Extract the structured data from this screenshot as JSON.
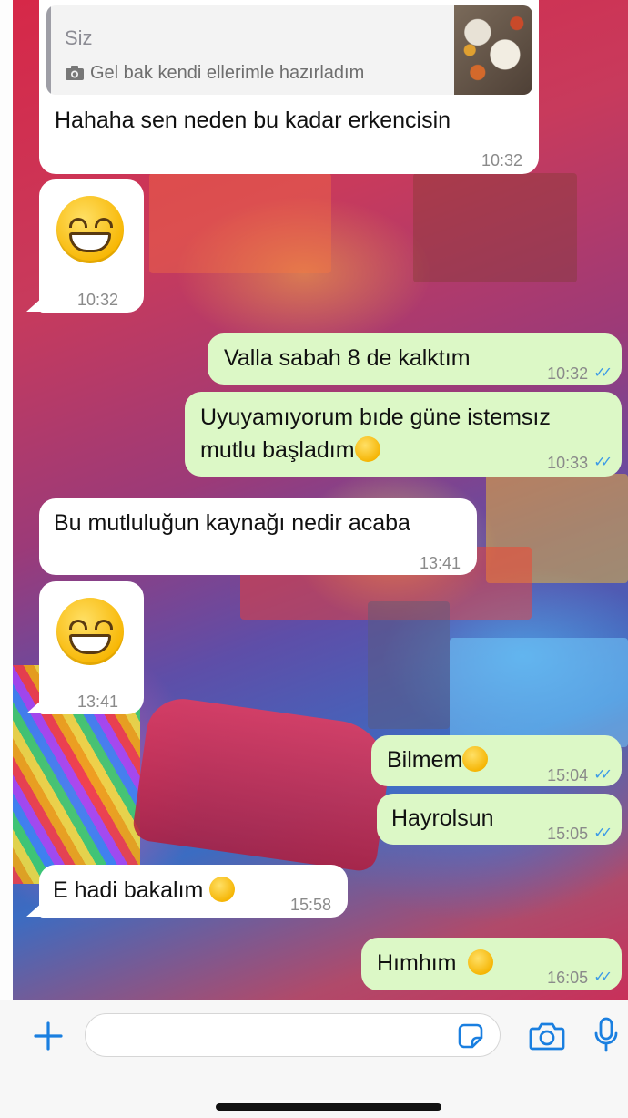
{
  "messages": [
    {
      "id": "m1",
      "direction": "incoming",
      "reply_to": {
        "author": "Siz",
        "icon": "camera-icon",
        "text": "Gel bak kendi ellerimle hazırladım"
      },
      "text": "Hahaha sen neden bu kadar erkencisin",
      "time": "10:32"
    },
    {
      "id": "m2",
      "direction": "incoming",
      "emoji": "grinning-face",
      "time": "10:32"
    },
    {
      "id": "m3",
      "direction": "outgoing",
      "text": "Valla sabah 8 de kalktım",
      "time": "10:32",
      "status": "read"
    },
    {
      "id": "m4",
      "direction": "outgoing",
      "text_line1": "Uyuyamıyorum bıde güne istemsız",
      "text_line2": "mutlu başladım",
      "time": "10:33",
      "status": "read"
    },
    {
      "id": "m5",
      "direction": "incoming",
      "text": "Bu mutluluğun kaynağı nedir acaba",
      "time": "13:41"
    },
    {
      "id": "m6",
      "direction": "incoming",
      "emoji": "grinning-face",
      "time": "13:41"
    },
    {
      "id": "m7",
      "direction": "outgoing",
      "text": "Bilmem",
      "time": "15:04",
      "status": "read"
    },
    {
      "id": "m8",
      "direction": "outgoing",
      "text": "Hayrolsun",
      "time": "15:05",
      "status": "read"
    },
    {
      "id": "m9",
      "direction": "incoming",
      "text": "E hadi bakalım",
      "time": "15:58"
    },
    {
      "id": "m10",
      "direction": "outgoing",
      "text": "Hımhım",
      "time": "16:05",
      "status": "read"
    }
  ],
  "composer": {
    "placeholder": "",
    "icons": [
      "plus-icon",
      "sticker-icon",
      "camera-icon",
      "microphone-icon"
    ]
  },
  "colors": {
    "incoming_bubble": "#ffffff",
    "outgoing_bubble": "#dcf8c6",
    "read_ticks": "#3c9ae6",
    "accent": "#1a7fe0"
  }
}
